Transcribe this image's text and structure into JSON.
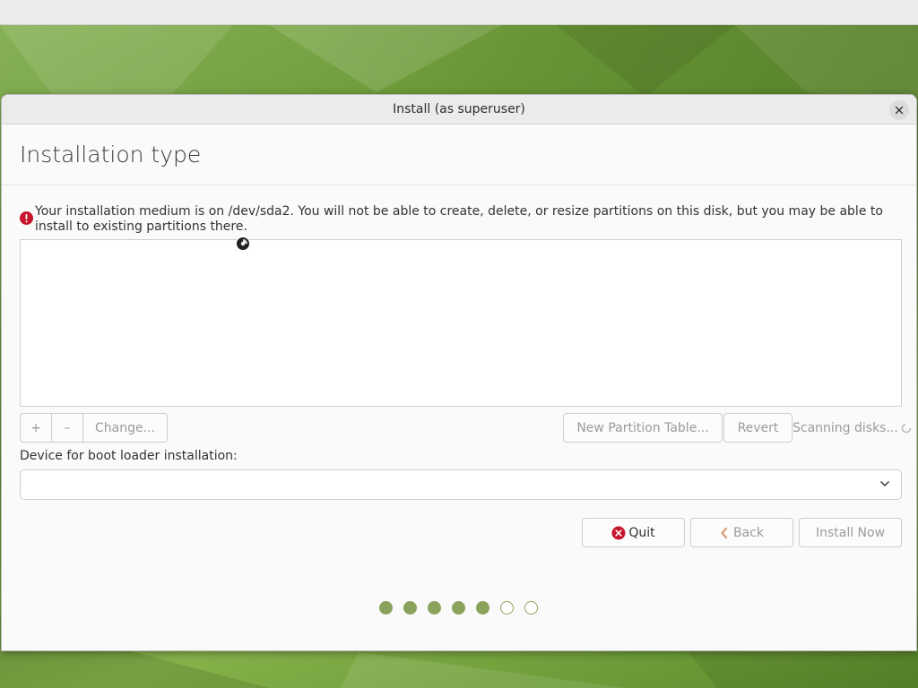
{
  "window": {
    "title": "Install (as superuser)"
  },
  "page": {
    "heading": "Installation type",
    "warning": "Your installation medium is on /dev/sda2. You will not be able to create, delete, or resize partitions on this disk, but you may be able to install to existing partitions there."
  },
  "partition_toolbar": {
    "add_label": "+",
    "remove_label": "–",
    "change_label": "Change...",
    "new_table_label": "New Partition Table...",
    "revert_label": "Revert",
    "status_text": "Scanning disks..."
  },
  "boot_loader": {
    "label": "Device for boot loader installation:",
    "selected_value": ""
  },
  "actions": {
    "quit_label": "Quit",
    "back_label": "Back",
    "install_label": "Install Now"
  },
  "progress": {
    "steps_total": 7,
    "steps_completed": 5
  },
  "colors": {
    "accent_green": "#8aa25c",
    "error_red": "#c7162b"
  },
  "icons": {
    "close": "close-icon",
    "warning": "error-icon",
    "quit": "quit-icon",
    "back": "chevron-left-icon",
    "dropdown": "chevron-down-icon",
    "spinner": "spinner-icon"
  }
}
